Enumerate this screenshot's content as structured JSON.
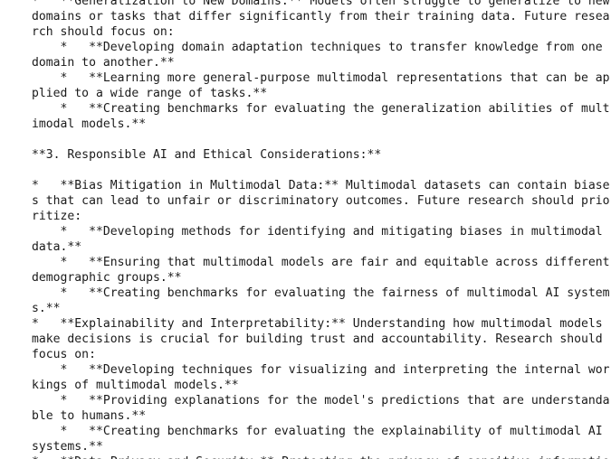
{
  "document": {
    "lines": [
      "*   **Generalization to New Domains:** Models often struggle to generalize to new",
      "domains or tasks that differ significantly from their training data. Future resea",
      "rch should focus on:",
      "    *   **Developing domain adaptation techniques to transfer knowledge from one",
      "domain to another.**",
      "    *   **Learning more general-purpose multimodal representations that can be ap",
      "plied to a wide range of tasks.**",
      "    *   **Creating benchmarks for evaluating the generalization abilities of mult",
      "imodal models.**",
      "",
      "**3. Responsible AI and Ethical Considerations:**",
      "",
      "*   **Bias Mitigation in Multimodal Data:** Multimodal datasets can contain biase",
      "s that can lead to unfair or discriminatory outcomes. Future research should prio",
      "ritize:",
      "    *   **Developing methods for identifying and mitigating biases in multimodal",
      "data.**",
      "    *   **Ensuring that multimodal models are fair and equitable across different",
      "demographic groups.**",
      "    *   **Creating benchmarks for evaluating the fairness of multimodal AI system",
      "s.**",
      "*   **Explainability and Interpretability:** Understanding how multimodal models",
      "make decisions is crucial for building trust and accountability. Research should",
      "focus on:",
      "    *   **Developing techniques for visualizing and interpreting the internal wor",
      "kings of multimodal models.**",
      "    *   **Providing explanations for the model's predictions that are understanda",
      "ble to humans.**",
      "    *   **Creating benchmarks for evaluating the explainability of multimodal AI",
      "systems.**",
      "*   **Data Privacy and Security:** Protecting the privacy of sensitive informatio"
    ]
  }
}
